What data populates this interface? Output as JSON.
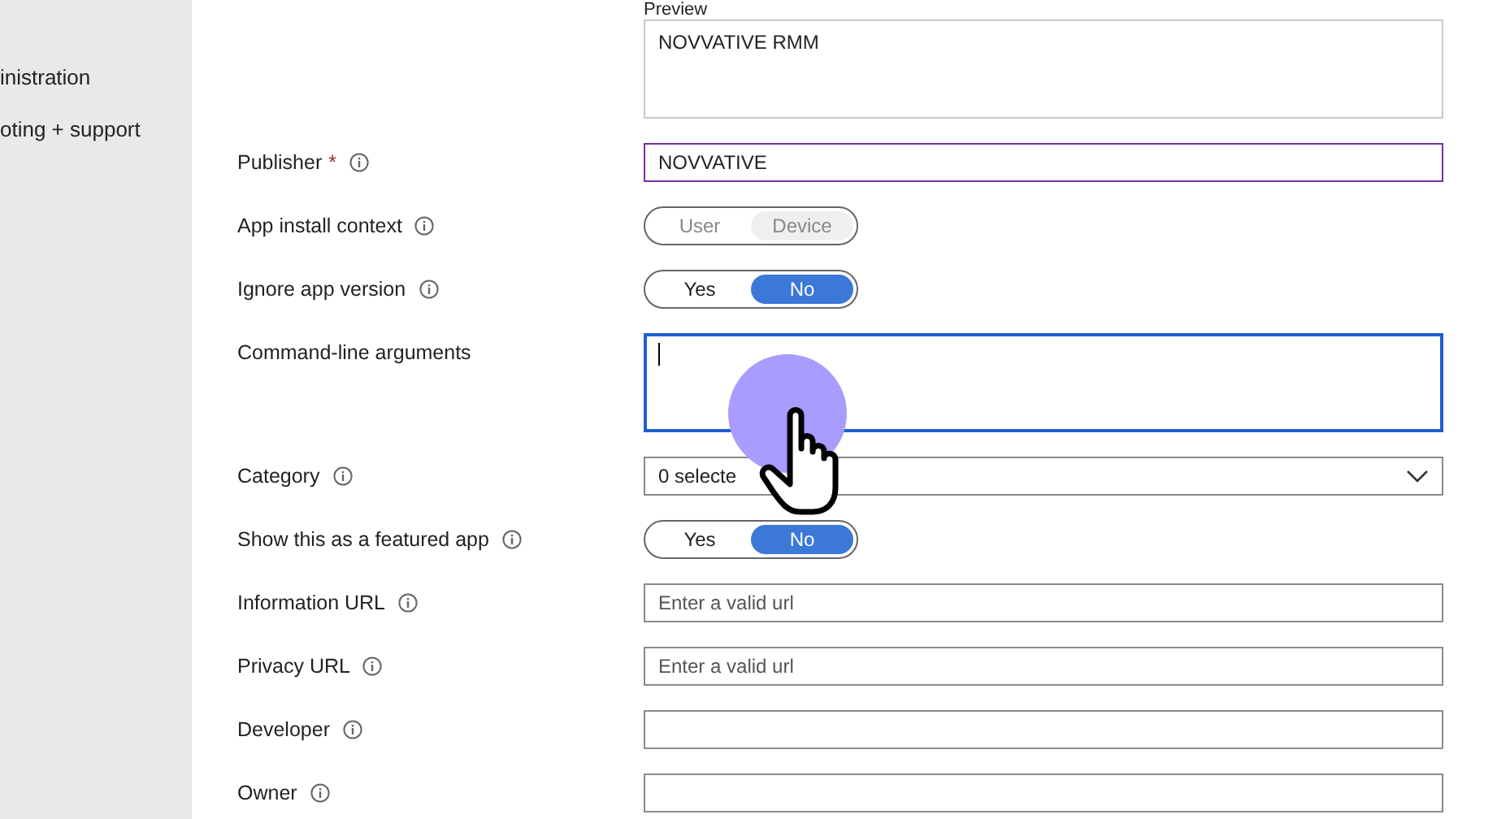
{
  "sidebar": {
    "items": [
      {
        "label": "inistration"
      },
      {
        "label": "oting + support"
      }
    ]
  },
  "preview": {
    "label": "Preview",
    "value": "NOVVATIVE RMM"
  },
  "fields": [
    {
      "kind": "text",
      "label": "Publisher",
      "required_mark": "*",
      "value": "NOVVATIVE",
      "highlighted": true
    },
    {
      "kind": "toggle",
      "label": "App install context",
      "disabled": true,
      "options": [
        {
          "label": "User",
          "selected": false
        },
        {
          "label": "Device",
          "selected": true
        }
      ]
    },
    {
      "kind": "toggle",
      "label": "Ignore app version",
      "disabled": false,
      "options": [
        {
          "label": "Yes",
          "selected": false
        },
        {
          "label": "No",
          "selected": true
        }
      ]
    },
    {
      "kind": "textarea",
      "label": "Command-line arguments",
      "focused": true
    },
    {
      "kind": "dropdown",
      "label": "Category",
      "value": "0 selecte"
    },
    {
      "kind": "toggle",
      "label": "Show this as a featured app",
      "disabled": false,
      "options": [
        {
          "label": "Yes",
          "selected": false
        },
        {
          "label": "No",
          "selected": true
        }
      ]
    },
    {
      "kind": "text",
      "label": "Information URL",
      "placeholder": "Enter a valid url"
    },
    {
      "kind": "text",
      "label": "Privacy URL",
      "placeholder": "Enter a valid url"
    },
    {
      "kind": "text",
      "label": "Developer"
    },
    {
      "kind": "text",
      "label": "Owner"
    }
  ]
}
